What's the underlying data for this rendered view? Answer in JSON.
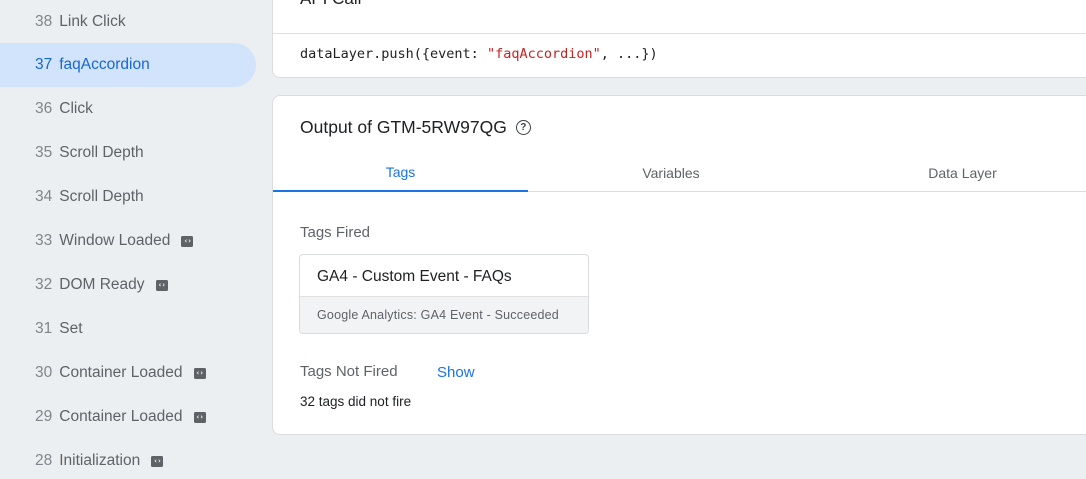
{
  "sidebar": {
    "items": [
      {
        "num": "38",
        "label": "Link Click",
        "sdk": false,
        "active": false
      },
      {
        "num": "37",
        "label": "faqAccordion",
        "sdk": false,
        "active": true
      },
      {
        "num": "36",
        "label": "Click",
        "sdk": false,
        "active": false
      },
      {
        "num": "35",
        "label": "Scroll Depth",
        "sdk": false,
        "active": false
      },
      {
        "num": "34",
        "label": "Scroll Depth",
        "sdk": false,
        "active": false
      },
      {
        "num": "33",
        "label": "Window Loaded",
        "sdk": true,
        "active": false
      },
      {
        "num": "32",
        "label": "DOM Ready",
        "sdk": true,
        "active": false
      },
      {
        "num": "31",
        "label": "Set",
        "sdk": false,
        "active": false
      },
      {
        "num": "30",
        "label": "Container Loaded",
        "sdk": true,
        "active": false
      },
      {
        "num": "29",
        "label": "Container Loaded",
        "sdk": true,
        "active": false
      },
      {
        "num": "28",
        "label": "Initialization",
        "sdk": true,
        "active": false
      }
    ],
    "sdk_icon_glyph": "‹›"
  },
  "api_call": {
    "title": "API Call",
    "code_prefix": "dataLayer.push({event: ",
    "code_string": "\"faqAccordion\"",
    "code_suffix": ", ...})"
  },
  "output": {
    "title": "Output of GTM-5RW97QG",
    "help_icon": "?",
    "tabs": [
      {
        "label": "Tags",
        "active": true
      },
      {
        "label": "Variables",
        "active": false
      },
      {
        "label": "Data Layer",
        "active": false
      }
    ],
    "tags_fired_label": "Tags Fired",
    "fired_tag": {
      "name": "GA4 - Custom Event - FAQs",
      "status": "Google Analytics: GA4 Event - Succeeded"
    },
    "tags_not_fired_label": "Tags Not Fired",
    "show_label": "Show",
    "not_fired_note": "32 tags did not fire"
  },
  "colors": {
    "accent": "#1a73e8",
    "active_item_bg": "#d2e3fc",
    "page_bg": "#eceff1",
    "code_string": "#c5221f"
  }
}
